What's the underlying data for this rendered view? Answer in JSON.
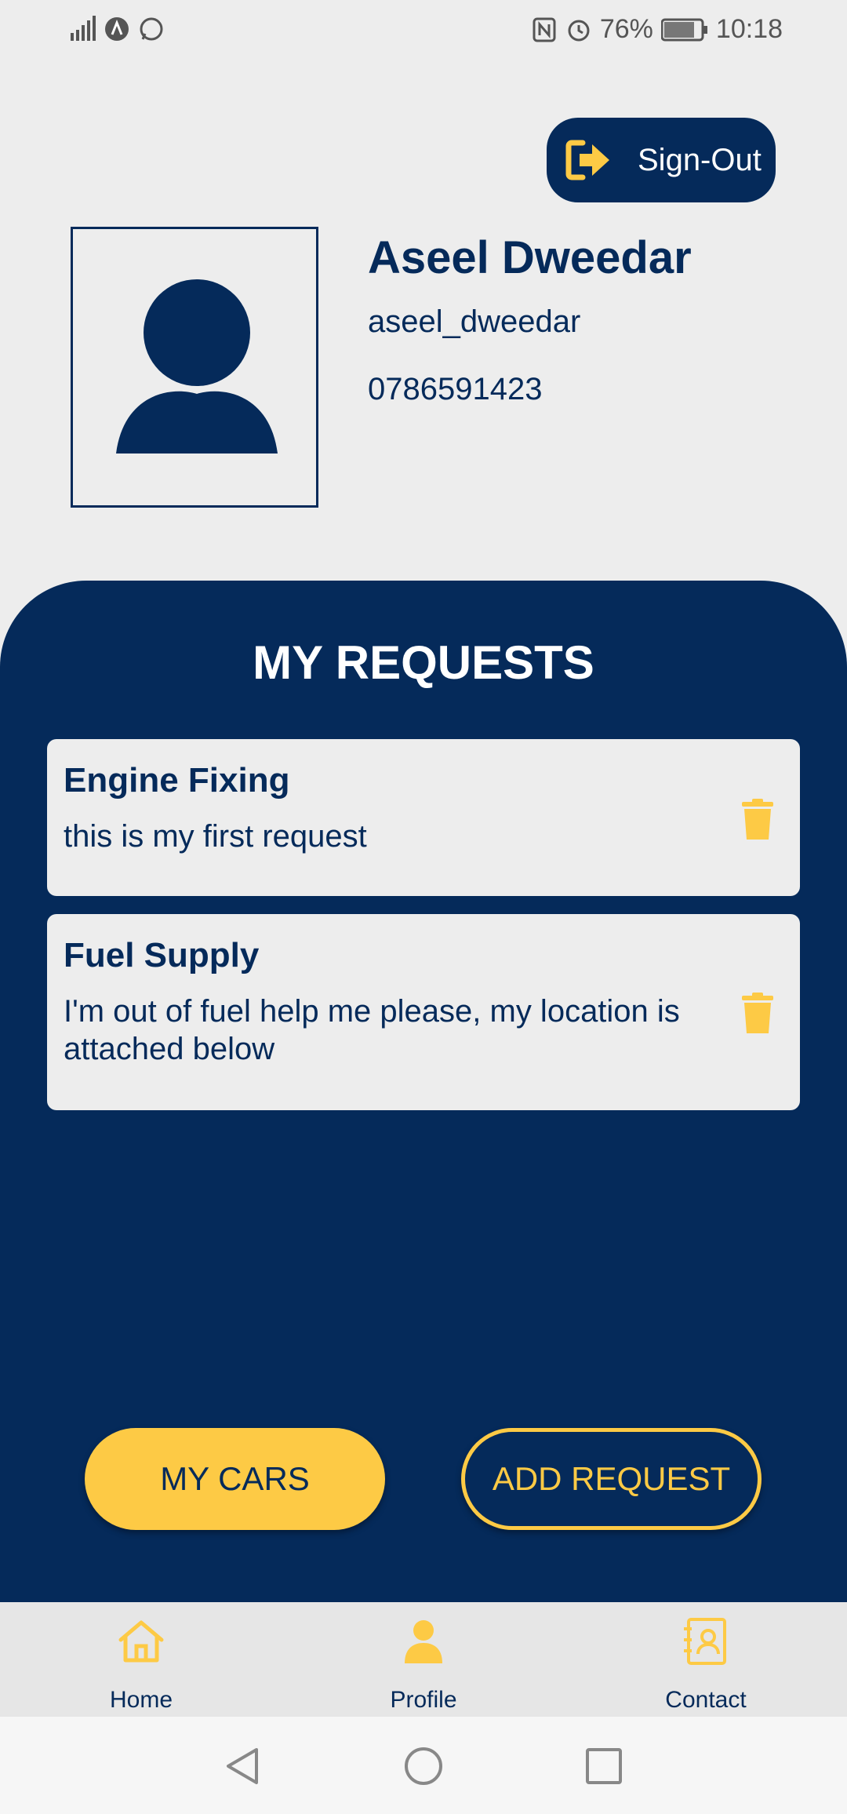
{
  "status_bar": {
    "battery": "76%",
    "time": "10:18"
  },
  "header": {
    "signout_label": "Sign-Out"
  },
  "profile": {
    "name": "Aseel Dweedar",
    "username": "aseel_dweedar",
    "phone": "0786591423"
  },
  "requests": {
    "title": "MY REQUESTS",
    "items": [
      {
        "title": "Engine Fixing",
        "description": "this is my first request"
      },
      {
        "title": "Fuel Supply",
        "description": "I'm out of fuel help me please, my location is attached below"
      }
    ]
  },
  "actions": {
    "my_cars": "MY CARS",
    "add_request": "ADD REQUEST"
  },
  "bottom_nav": {
    "items": [
      {
        "label": "Home",
        "icon": "home-icon"
      },
      {
        "label": "Profile",
        "icon": "person-icon"
      },
      {
        "label": "Contact",
        "icon": "contact-card-icon"
      }
    ]
  },
  "colors": {
    "primary": "#052a5a",
    "accent": "#fdca45",
    "background": "#ededed"
  }
}
